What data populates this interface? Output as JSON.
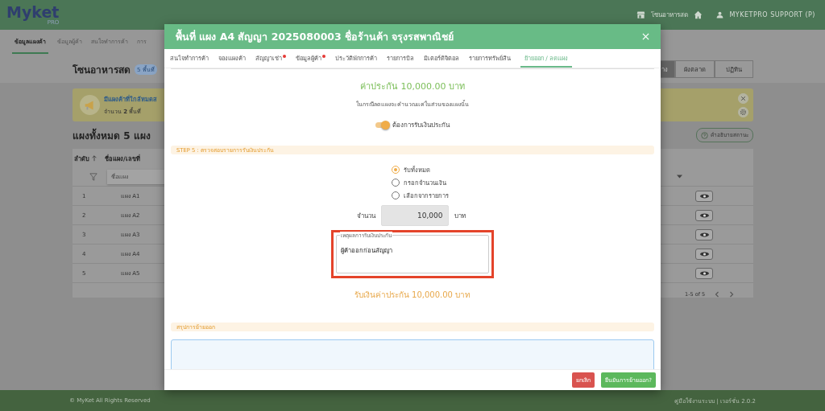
{
  "app_header": {
    "logo": "Myket",
    "logo_sub": "PRO",
    "zone": "โซนอาหารสด",
    "user": "MYKETPRO SUPPORT (P)"
  },
  "nav_tabs": [
    {
      "label": "ข้อมูลแผงค้า",
      "selected": true
    },
    {
      "label": "ข้อมูลผู้ค้า",
      "selected": false
    },
    {
      "label": "สนใจทำการค้า",
      "selected": false
    },
    {
      "label": "การ",
      "selected": false
    }
  ],
  "page": {
    "title": "โซนอาหารสด",
    "badge": "5 พื้นที่"
  },
  "view_buttons": [
    {
      "label": "าง",
      "selected": true
    },
    {
      "label": "ผังตลาด",
      "selected": false
    },
    {
      "label": "ปฏิทิน",
      "selected": false
    }
  ],
  "alert": {
    "title": "มีแผงค้าที่ใกล้หมดส",
    "text": "จำนวน **2** พื้นที่"
  },
  "section_title": "แผงทั้งหมด 5 แผง",
  "status_help_button": "คำอธิบายสถานะ",
  "table": {
    "columns": [
      "ลำดับ",
      "ชื่อแผง/เลขที่"
    ],
    "filter_placeholder": "ชื่อแผง",
    "rows": [
      {
        "no": "1",
        "name": "แผง A1"
      },
      {
        "no": "2",
        "name": "แผง A2"
      },
      {
        "no": "3",
        "name": "แผง A3"
      },
      {
        "no": "4",
        "name": "แผง A4"
      },
      {
        "no": "5",
        "name": "แผง A5"
      }
    ],
    "pagination": "1-5 of 5"
  },
  "footer": {
    "copyright": "© MyKet All Rights Reserved",
    "links": "คู่มือใช้งานระบบ | เวอร์ชั่น 2.0.2"
  },
  "modal": {
    "title": "พื้นที่ แผง A4 สัญญา 2025080003 ชื่อร้านค้า จรุงรสพาณิชย์",
    "tabs": [
      {
        "label": "สนใจทำการค้า",
        "selected": false,
        "flagged": false
      },
      {
        "label": "จองแผงค้า",
        "selected": false,
        "flagged": false
      },
      {
        "label": "สัญญาเช่า",
        "selected": false,
        "flagged": true
      },
      {
        "label": "ข้อมูลผู้ค้า",
        "selected": false,
        "flagged": true
      },
      {
        "label": "ประวัติพักการค้า",
        "selected": false,
        "flagged": false
      },
      {
        "label": "รายการบิล",
        "selected": false,
        "flagged": false
      },
      {
        "label": "มิเตอร์ดิจิตอล",
        "selected": false,
        "flagged": false
      },
      {
        "label": "รายการทรัพย์สิน",
        "selected": false,
        "flagged": false
      },
      {
        "label": "ย้ายออก / ลดแผง",
        "selected": true,
        "flagged": false
      }
    ],
    "deposit_title": "ค่าประกัน 10,000.00 บาท",
    "deposit_note": "ในกรณีลดแผงจะคำนวณแค่ในส่วนของแผงนั้น",
    "refund_toggle": {
      "label": "ต้องการรับเงินประกัน",
      "on": true
    },
    "step_title": "STEP 5 : ตรวจสอบรายการรับเงินประกัน",
    "options": [
      {
        "label": "รับทั้งหมด",
        "selected": true
      },
      {
        "label": "กรอกจำนวนเงิน",
        "selected": false
      },
      {
        "label": "เลือกจากรายการ",
        "selected": false
      }
    ],
    "amount": {
      "label": "จำนวน",
      "value": "10,000",
      "unit": "บาท"
    },
    "reason": {
      "label": "เหตุผลการรับเงินประกัน",
      "value": "ผู้ค้าออกก่อนสัญญา",
      "highlighted": true
    },
    "refund_total": "รับเงินค่าประกัน 10,000.00 บาท",
    "summary_title": "สรุปการย้ายออก",
    "buttons": [
      {
        "label": "ยกเลิก",
        "kind": "cancel"
      },
      {
        "label": "ยืนยันการย้ายออก?",
        "kind": "confirm"
      }
    ]
  }
}
